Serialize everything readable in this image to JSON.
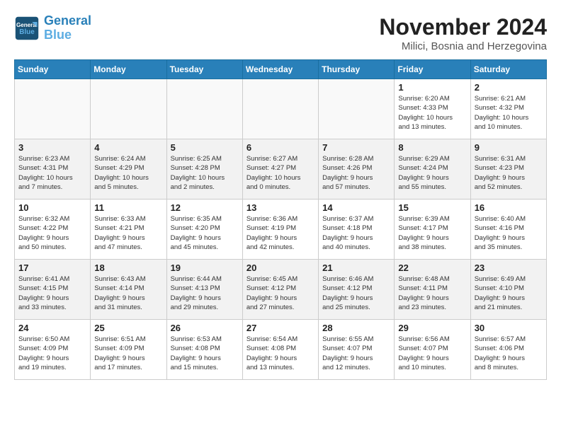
{
  "logo": {
    "line1": "General",
    "line2": "Blue"
  },
  "title": "November 2024",
  "subtitle": "Milici, Bosnia and Herzegovina",
  "days_of_week": [
    "Sunday",
    "Monday",
    "Tuesday",
    "Wednesday",
    "Thursday",
    "Friday",
    "Saturday"
  ],
  "weeks": [
    [
      {
        "day": "",
        "info": ""
      },
      {
        "day": "",
        "info": ""
      },
      {
        "day": "",
        "info": ""
      },
      {
        "day": "",
        "info": ""
      },
      {
        "day": "",
        "info": ""
      },
      {
        "day": "1",
        "info": "Sunrise: 6:20 AM\nSunset: 4:33 PM\nDaylight: 10 hours\nand 13 minutes."
      },
      {
        "day": "2",
        "info": "Sunrise: 6:21 AM\nSunset: 4:32 PM\nDaylight: 10 hours\nand 10 minutes."
      }
    ],
    [
      {
        "day": "3",
        "info": "Sunrise: 6:23 AM\nSunset: 4:31 PM\nDaylight: 10 hours\nand 7 minutes."
      },
      {
        "day": "4",
        "info": "Sunrise: 6:24 AM\nSunset: 4:29 PM\nDaylight: 10 hours\nand 5 minutes."
      },
      {
        "day": "5",
        "info": "Sunrise: 6:25 AM\nSunset: 4:28 PM\nDaylight: 10 hours\nand 2 minutes."
      },
      {
        "day": "6",
        "info": "Sunrise: 6:27 AM\nSunset: 4:27 PM\nDaylight: 10 hours\nand 0 minutes."
      },
      {
        "day": "7",
        "info": "Sunrise: 6:28 AM\nSunset: 4:26 PM\nDaylight: 9 hours\nand 57 minutes."
      },
      {
        "day": "8",
        "info": "Sunrise: 6:29 AM\nSunset: 4:24 PM\nDaylight: 9 hours\nand 55 minutes."
      },
      {
        "day": "9",
        "info": "Sunrise: 6:31 AM\nSunset: 4:23 PM\nDaylight: 9 hours\nand 52 minutes."
      }
    ],
    [
      {
        "day": "10",
        "info": "Sunrise: 6:32 AM\nSunset: 4:22 PM\nDaylight: 9 hours\nand 50 minutes."
      },
      {
        "day": "11",
        "info": "Sunrise: 6:33 AM\nSunset: 4:21 PM\nDaylight: 9 hours\nand 47 minutes."
      },
      {
        "day": "12",
        "info": "Sunrise: 6:35 AM\nSunset: 4:20 PM\nDaylight: 9 hours\nand 45 minutes."
      },
      {
        "day": "13",
        "info": "Sunrise: 6:36 AM\nSunset: 4:19 PM\nDaylight: 9 hours\nand 42 minutes."
      },
      {
        "day": "14",
        "info": "Sunrise: 6:37 AM\nSunset: 4:18 PM\nDaylight: 9 hours\nand 40 minutes."
      },
      {
        "day": "15",
        "info": "Sunrise: 6:39 AM\nSunset: 4:17 PM\nDaylight: 9 hours\nand 38 minutes."
      },
      {
        "day": "16",
        "info": "Sunrise: 6:40 AM\nSunset: 4:16 PM\nDaylight: 9 hours\nand 35 minutes."
      }
    ],
    [
      {
        "day": "17",
        "info": "Sunrise: 6:41 AM\nSunset: 4:15 PM\nDaylight: 9 hours\nand 33 minutes."
      },
      {
        "day": "18",
        "info": "Sunrise: 6:43 AM\nSunset: 4:14 PM\nDaylight: 9 hours\nand 31 minutes."
      },
      {
        "day": "19",
        "info": "Sunrise: 6:44 AM\nSunset: 4:13 PM\nDaylight: 9 hours\nand 29 minutes."
      },
      {
        "day": "20",
        "info": "Sunrise: 6:45 AM\nSunset: 4:12 PM\nDaylight: 9 hours\nand 27 minutes."
      },
      {
        "day": "21",
        "info": "Sunrise: 6:46 AM\nSunset: 4:12 PM\nDaylight: 9 hours\nand 25 minutes."
      },
      {
        "day": "22",
        "info": "Sunrise: 6:48 AM\nSunset: 4:11 PM\nDaylight: 9 hours\nand 23 minutes."
      },
      {
        "day": "23",
        "info": "Sunrise: 6:49 AM\nSunset: 4:10 PM\nDaylight: 9 hours\nand 21 minutes."
      }
    ],
    [
      {
        "day": "24",
        "info": "Sunrise: 6:50 AM\nSunset: 4:09 PM\nDaylight: 9 hours\nand 19 minutes."
      },
      {
        "day": "25",
        "info": "Sunrise: 6:51 AM\nSunset: 4:09 PM\nDaylight: 9 hours\nand 17 minutes."
      },
      {
        "day": "26",
        "info": "Sunrise: 6:53 AM\nSunset: 4:08 PM\nDaylight: 9 hours\nand 15 minutes."
      },
      {
        "day": "27",
        "info": "Sunrise: 6:54 AM\nSunset: 4:08 PM\nDaylight: 9 hours\nand 13 minutes."
      },
      {
        "day": "28",
        "info": "Sunrise: 6:55 AM\nSunset: 4:07 PM\nDaylight: 9 hours\nand 12 minutes."
      },
      {
        "day": "29",
        "info": "Sunrise: 6:56 AM\nSunset: 4:07 PM\nDaylight: 9 hours\nand 10 minutes."
      },
      {
        "day": "30",
        "info": "Sunrise: 6:57 AM\nSunset: 4:06 PM\nDaylight: 9 hours\nand 8 minutes."
      }
    ]
  ]
}
